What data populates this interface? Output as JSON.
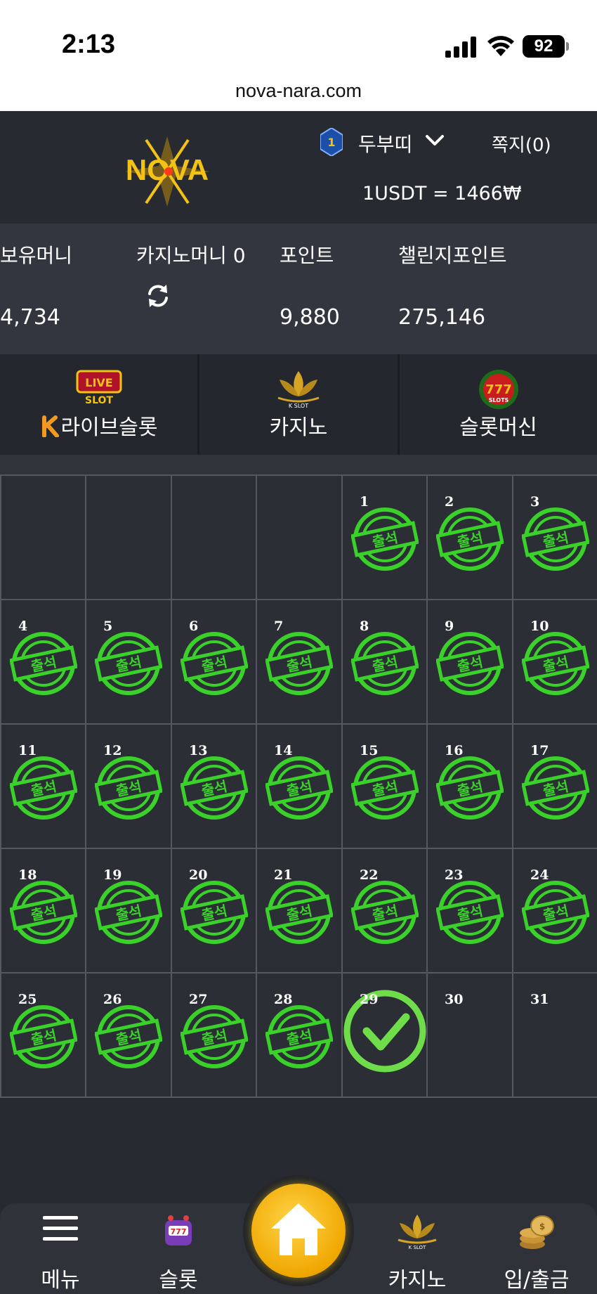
{
  "status_bar": {
    "time": "2:13",
    "battery": "92"
  },
  "browser": {
    "url": "nova-nara.com"
  },
  "header": {
    "logo_text": "NOVA",
    "level": "1",
    "username": "두부띠",
    "messages_label": "쪽지(0)",
    "exchange_rate": "1USDT = 1466₩"
  },
  "balances": {
    "holding": {
      "label": "보유머니",
      "value": "4,734"
    },
    "casino": {
      "label": "카지노머니 0"
    },
    "points": {
      "label": "포인트",
      "value": "9,880"
    },
    "challenge_points": {
      "label": "챌린지포인트",
      "value": "275,146"
    }
  },
  "game_tabs": [
    {
      "label": "라이브슬롯",
      "icon": "live-slot-logo",
      "prefix_icon": "k-logo"
    },
    {
      "label": "카지노",
      "icon": "k-slot-lotus-logo"
    },
    {
      "label": "슬롯머신",
      "icon": "777-slots-logo"
    }
  ],
  "calendar": {
    "stamp_text": "출석",
    "first_weekday_index": 4,
    "days": [
      {
        "day": "1",
        "attended": true
      },
      {
        "day": "2",
        "attended": true
      },
      {
        "day": "3",
        "attended": true
      },
      {
        "day": "4",
        "attended": true
      },
      {
        "day": "5",
        "attended": true
      },
      {
        "day": "6",
        "attended": true
      },
      {
        "day": "7",
        "attended": true
      },
      {
        "day": "8",
        "attended": true
      },
      {
        "day": "9",
        "attended": true
      },
      {
        "day": "10",
        "attended": true
      },
      {
        "day": "11",
        "attended": true
      },
      {
        "day": "12",
        "attended": true
      },
      {
        "day": "13",
        "attended": true
      },
      {
        "day": "14",
        "attended": true
      },
      {
        "day": "15",
        "attended": true
      },
      {
        "day": "16",
        "attended": true
      },
      {
        "day": "17",
        "attended": true
      },
      {
        "day": "18",
        "attended": true
      },
      {
        "day": "19",
        "attended": true
      },
      {
        "day": "20",
        "attended": true
      },
      {
        "day": "21",
        "attended": true
      },
      {
        "day": "22",
        "attended": true
      },
      {
        "day": "23",
        "attended": true
      },
      {
        "day": "24",
        "attended": true
      },
      {
        "day": "25",
        "attended": true
      },
      {
        "day": "26",
        "attended": true
      },
      {
        "day": "27",
        "attended": true
      },
      {
        "day": "28",
        "attended": true
      },
      {
        "day": "29",
        "attended": false,
        "checked": true
      },
      {
        "day": "30",
        "attended": false
      },
      {
        "day": "31",
        "attended": false
      }
    ]
  },
  "bottom_nav": [
    {
      "label": "메뉴",
      "icon": "hamburger-icon"
    },
    {
      "label": "슬롯",
      "icon": "slot-machine-icon"
    },
    {
      "label": "",
      "icon": "home-icon"
    },
    {
      "label": "카지노",
      "icon": "k-slot-lotus-icon"
    },
    {
      "label": "입/출금",
      "icon": "coins-icon"
    }
  ],
  "colors": {
    "stamp_green": "#3ad12a",
    "check_green": "#6fdc4a",
    "home_gold": "#f0a700",
    "logo_gold": "#f2c314"
  }
}
